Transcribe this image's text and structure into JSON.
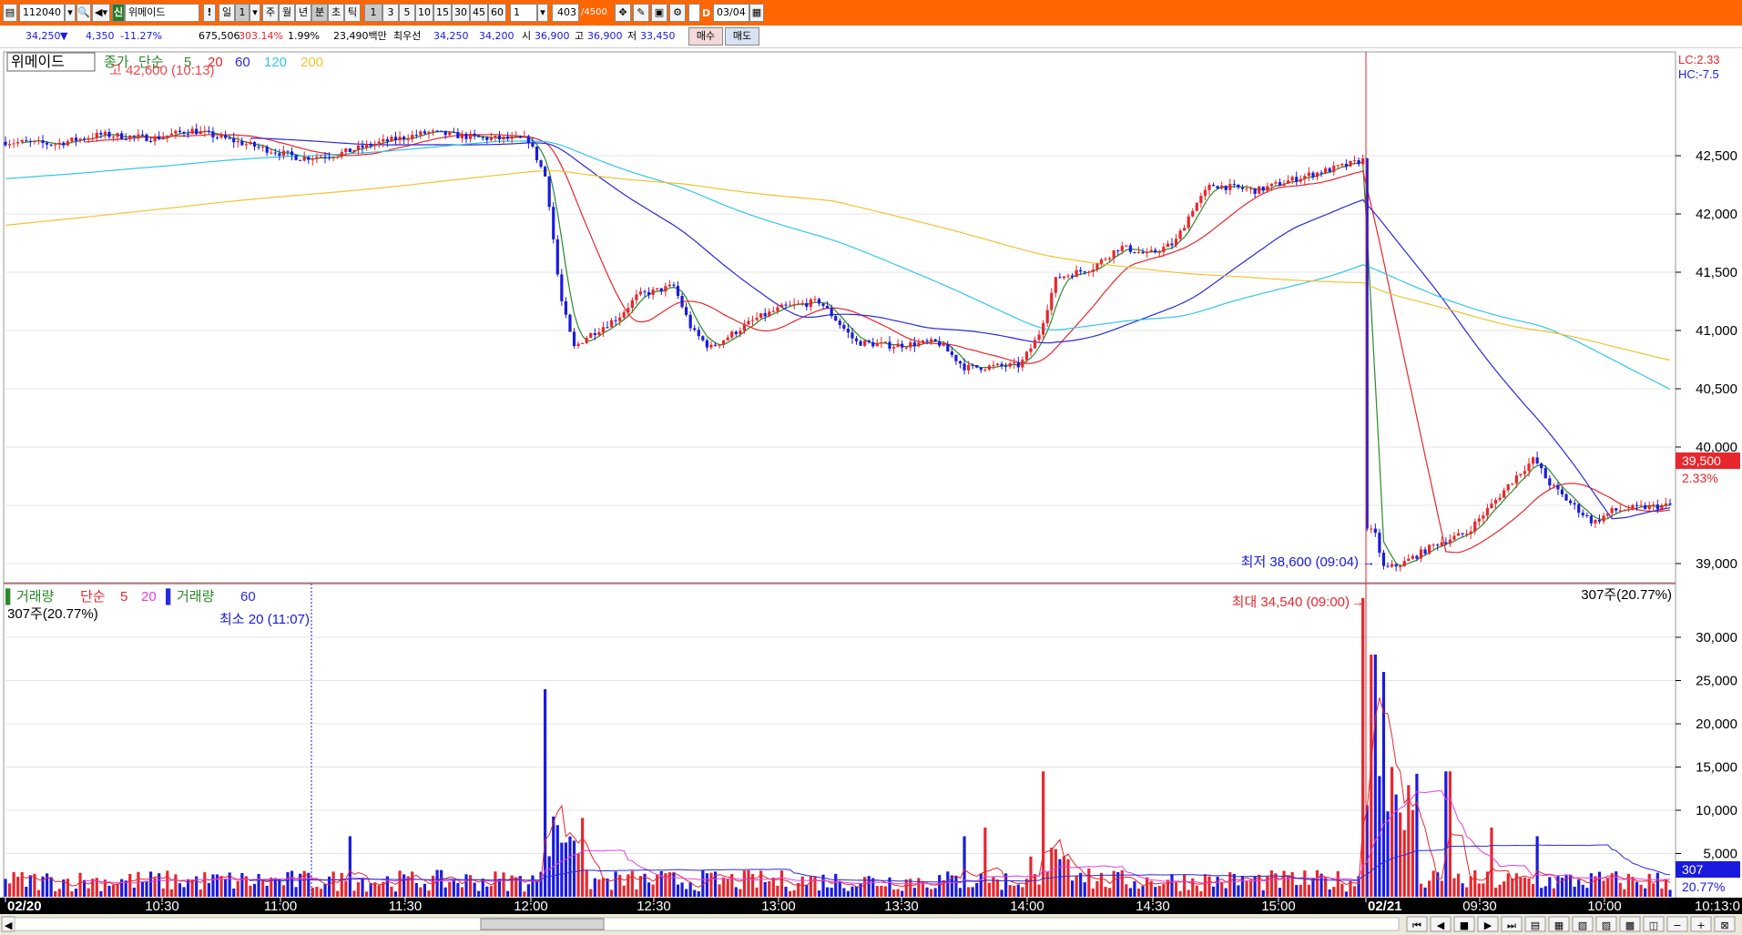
{
  "toolbar": {
    "code": "112040",
    "name": "위메이드",
    "exclaim": "!",
    "periods": [
      "일",
      "1",
      "주",
      "월",
      "년",
      "분",
      "초",
      "틱"
    ],
    "intervals": [
      "1",
      "3",
      "5",
      "10",
      "15",
      "30",
      "45",
      "60"
    ],
    "count_value": "1",
    "bars_shown": "403",
    "bars_total": "/4500",
    "d_label": "D",
    "date": "03/04",
    "shin": "신"
  },
  "quote": {
    "price": "34,250",
    "change": "4,350",
    "change_pct": "-11.27%",
    "volume": "675,506",
    "vol_ratio": "303.14%",
    "turnover": "1.99%",
    "amount": "23,490백만",
    "best_label": "최우선",
    "best_ask": "34,250",
    "best_bid": "34,200",
    "open_label": "시",
    "open": "36,900",
    "high_label": "고",
    "high": "36,900",
    "low_label": "저",
    "low": "33,450",
    "buy": "매수",
    "sell": "매도"
  },
  "price_pane": {
    "legend_name": "위메이드",
    "legend_close": "종가",
    "legend_simple": "단순",
    "legend_periods": [
      "5",
      "20",
      "60",
      "120",
      "200"
    ],
    "tooltip": "고 42,600 (10:13)",
    "lc": "LC:2.33",
    "hc": "HC:-7.5",
    "y_ticks": [
      "42,500",
      "42,000",
      "41,500",
      "41,000",
      "40,500",
      "40,000",
      "39,000"
    ],
    "current_price": "39,500",
    "current_pct": "2.33%",
    "low_note": "최저 38,600 (09:04)"
  },
  "volume_pane": {
    "legend_vol": "거래량",
    "legend_simple": "단순",
    "legend_p1": "5",
    "legend_p2": "20",
    "legend_vol2": "거래량",
    "legend_p3": "60",
    "left_value": "307주(20.77%)",
    "right_value": "307주(20.77%)",
    "min_note": "최소 20 (11:07)",
    "max_note": "최대 34,540 (09:00)",
    "y_ticks": [
      "30,000",
      "25,000",
      "20,000",
      "15,000",
      "10,000",
      "5,000"
    ],
    "current_vol": "307",
    "current_vol_pct": "20.77%"
  },
  "x_axis": {
    "labels": [
      "02/20",
      "10:30",
      "11:00",
      "11:30",
      "12:00",
      "12:30",
      "13:00",
      "13:30",
      "14:00",
      "14:30",
      "15:00",
      "02/21",
      "09:30",
      "10:00"
    ],
    "right_time": "10:13:0"
  },
  "colors": {
    "toolbar_bg": "#ff6600",
    "up": "#e8262d",
    "down": "#1a1adf",
    "ma5": "#2a8a2a",
    "ma20": "#e8262d",
    "ma60": "#2a2adf",
    "ma120": "#33c6e8",
    "ma200": "#f2c230",
    "vol_ma5": "#e8262d",
    "vol_ma20": "#e040e0",
    "vol_ma60": "#2a2adf"
  }
}
